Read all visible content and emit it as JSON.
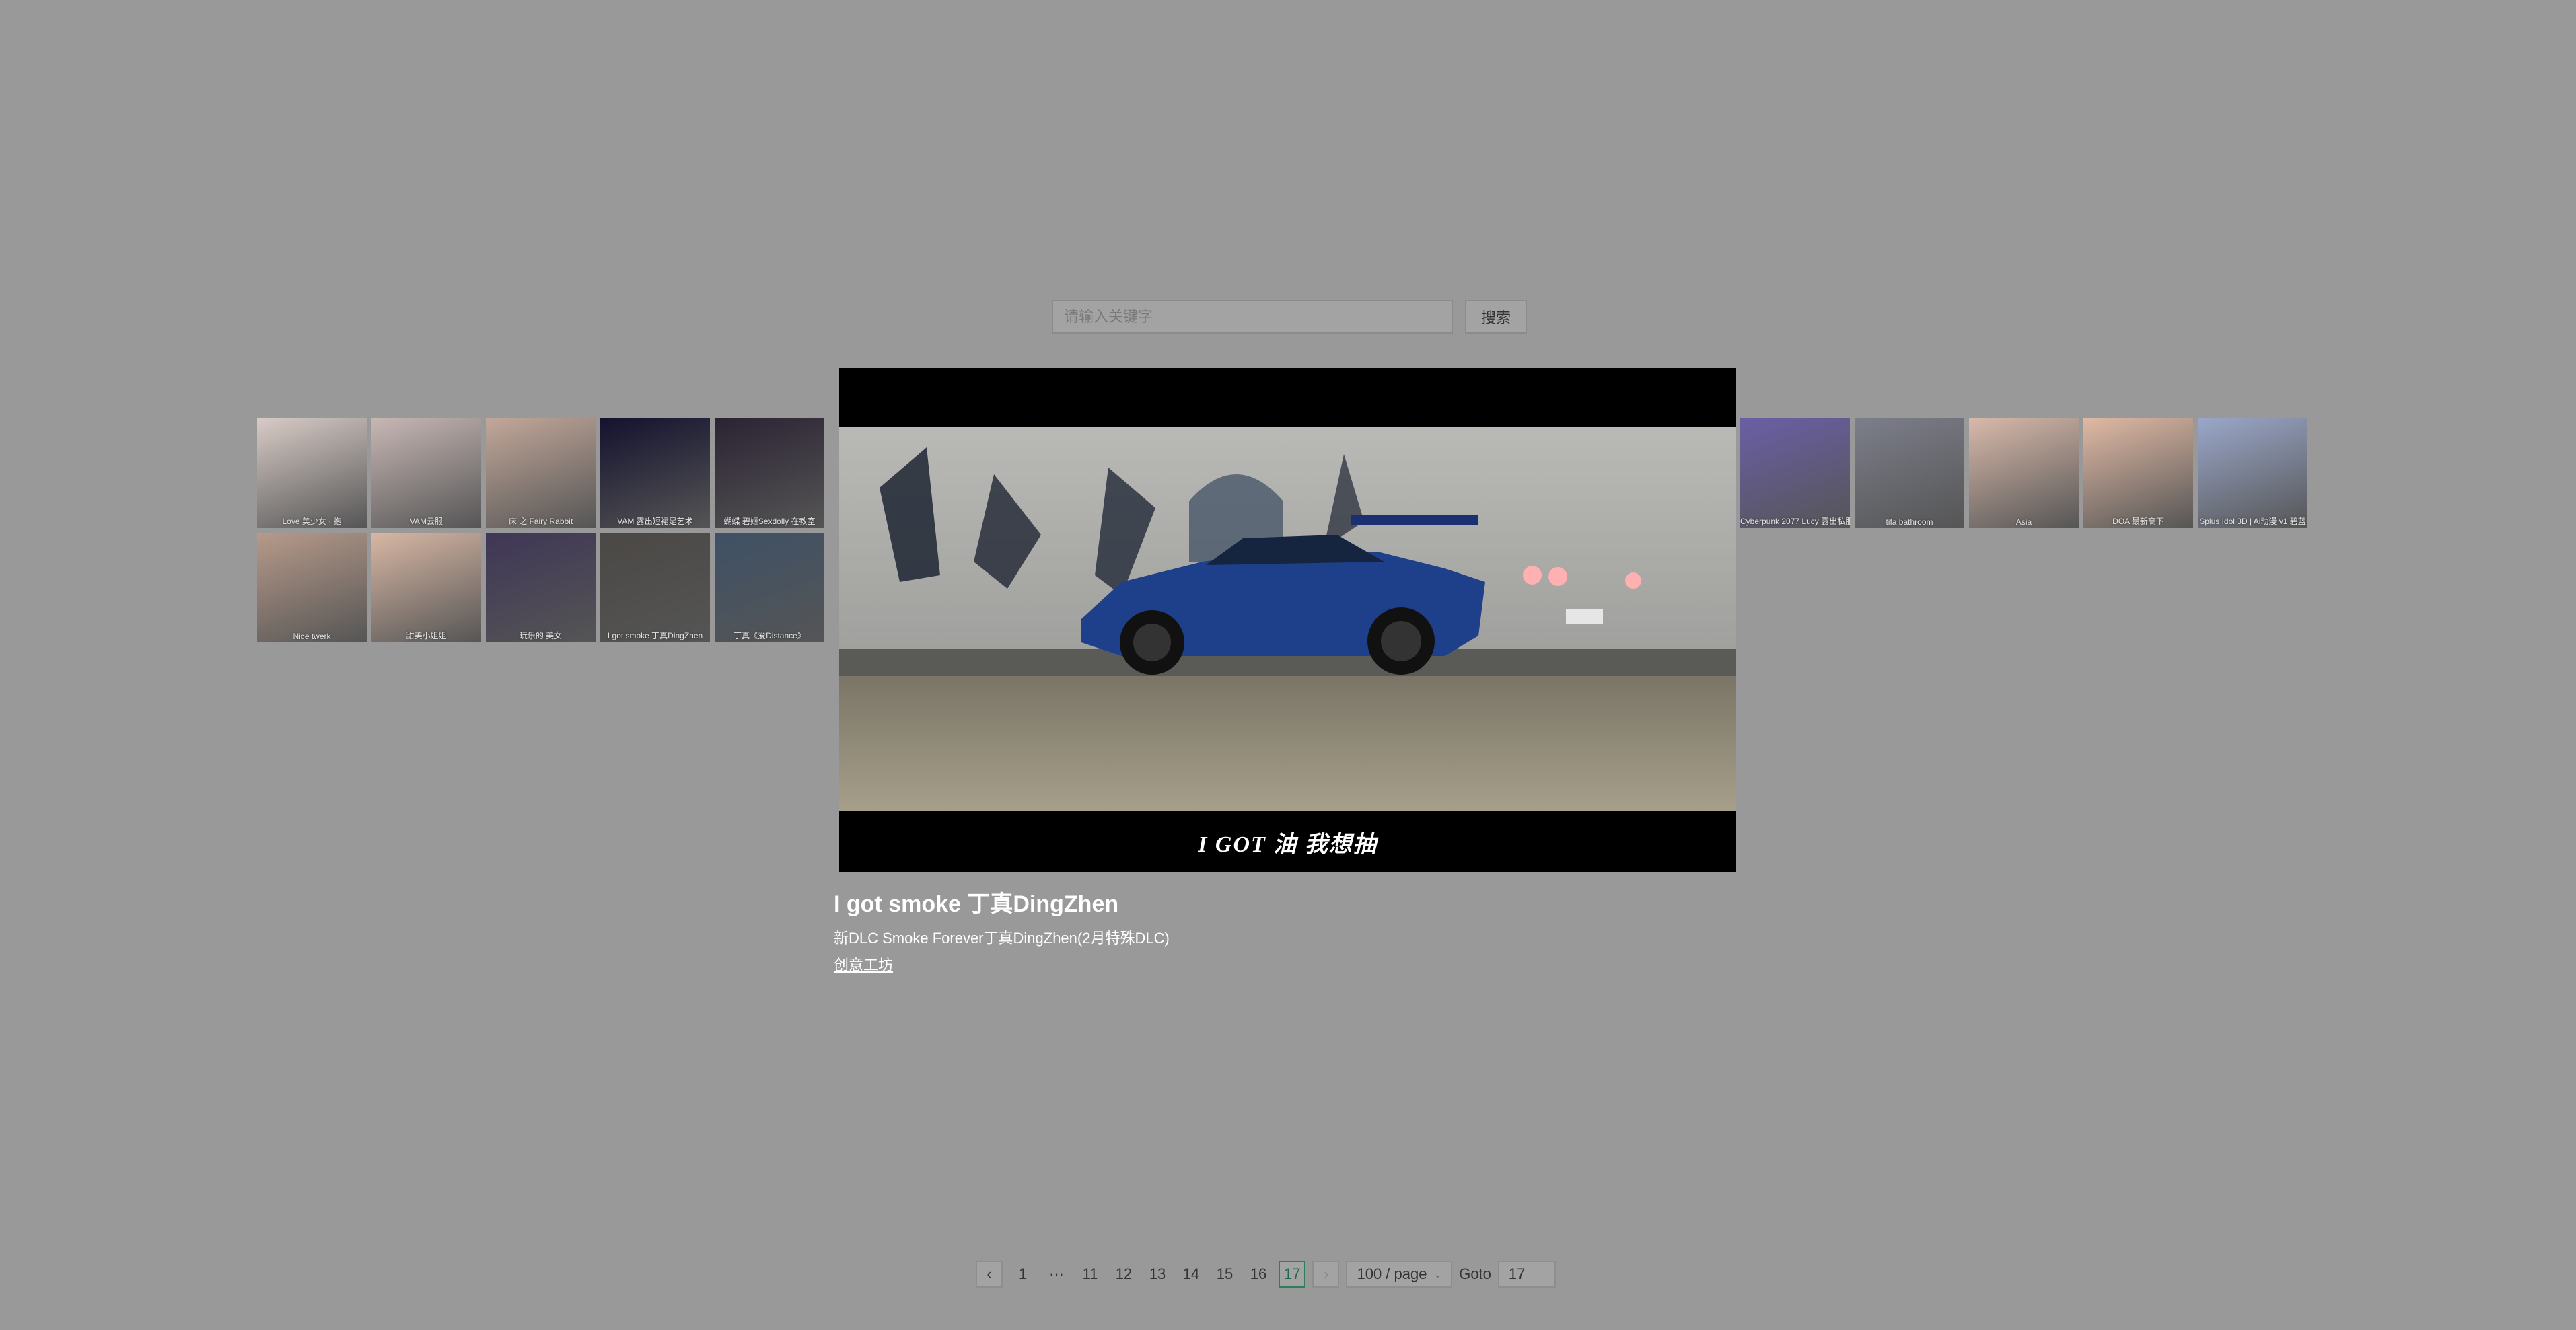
{
  "search": {
    "placeholder": "请输入关键字",
    "button_label": "搜索"
  },
  "gallery": {
    "row1": [
      {
        "caption": "Love 美少女 · 抱"
      },
      {
        "caption": "VAM云服"
      },
      {
        "caption": "床 之 Fairy Rabbit"
      },
      {
        "caption": "VAM 露出短裙是艺术"
      },
      {
        "caption": "蝴蝶 碧姬Sexdolly 在教室"
      },
      {
        "caption": "Cyberpunk 2077 Lucy 露出私服"
      },
      {
        "caption": "tifa bathroom"
      },
      {
        "caption": "Asia"
      },
      {
        "caption": "DOA 最新高下"
      },
      {
        "caption": "Splus Idol 3D | Ai动漫 v1 碧蓝"
      }
    ],
    "row2": [
      {
        "caption": "Nice twerk"
      },
      {
        "caption": "甜美小姐姐"
      },
      {
        "caption": "玩乐的 美女"
      },
      {
        "caption": "I got smoke 丁真DingZhen"
      },
      {
        "caption": "丁真《爱Distance》"
      }
    ],
    "colors": {
      "row1": [
        "#d7cbc6",
        "#c7b7b4",
        "#c2a799",
        "#14122e",
        "#2b2333",
        "#6a5fa6",
        "#7c7e8a",
        "#d8b9aa",
        "#e0b9a4",
        "#9aa7c9"
      ],
      "row2": [
        "#b79a8a",
        "#d8b7a4",
        "#3f3656",
        "#4b4845",
        "#3e5166"
      ]
    }
  },
  "preview": {
    "subtitle": "I GOT 油 我想抽",
    "title": "I got smoke 丁真DingZhen",
    "description": "新DLC Smoke Forever丁真DingZhen(2月特殊DLC)",
    "link_label": "创意工坊"
  },
  "pagination": {
    "prev_icon": "chevron-left-icon",
    "pages": [
      "1",
      "···",
      "11",
      "12",
      "13",
      "14",
      "15",
      "16",
      "17"
    ],
    "current": "17",
    "next_icon": "chevron-right-icon",
    "page_size": "100 / page",
    "goto_label": "Goto",
    "goto_value": "17"
  }
}
